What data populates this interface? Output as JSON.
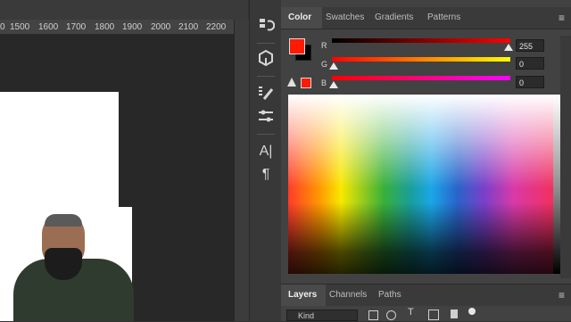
{
  "ruler": {
    "marks": [
      "1500",
      "1600",
      "1700",
      "1800",
      "1900",
      "2000",
      "2100",
      "2200"
    ]
  },
  "color_panel": {
    "tabs": [
      {
        "label": "Color",
        "active": true
      },
      {
        "label": "Swatches",
        "active": false
      },
      {
        "label": "Gradients",
        "active": false
      },
      {
        "label": "Patterns",
        "active": false
      }
    ],
    "foreground_color": "#ff1a00",
    "background_color": "#000000",
    "channels": [
      {
        "name": "R",
        "value": "255",
        "level": 1.0
      },
      {
        "name": "G",
        "value": "0",
        "level": 0.0
      },
      {
        "name": "B",
        "value": "0",
        "level": 0.0
      }
    ],
    "warning_icon": "warning-triangle-icon"
  },
  "tool_strip": {
    "icons": [
      "history-icon",
      "3d-cube-icon",
      "brush-settings-icon",
      "adjust-sliders-icon",
      "character-icon",
      "paragraph-icon"
    ],
    "char_label": "A|",
    "para_label": "¶"
  },
  "layers_panel": {
    "tabs": [
      {
        "label": "Layers",
        "active": true
      },
      {
        "label": "Channels",
        "active": false
      },
      {
        "label": "Paths",
        "active": false
      }
    ],
    "filter_text": "Kind"
  },
  "icons": {
    "menu": "panel-menu-icon"
  }
}
